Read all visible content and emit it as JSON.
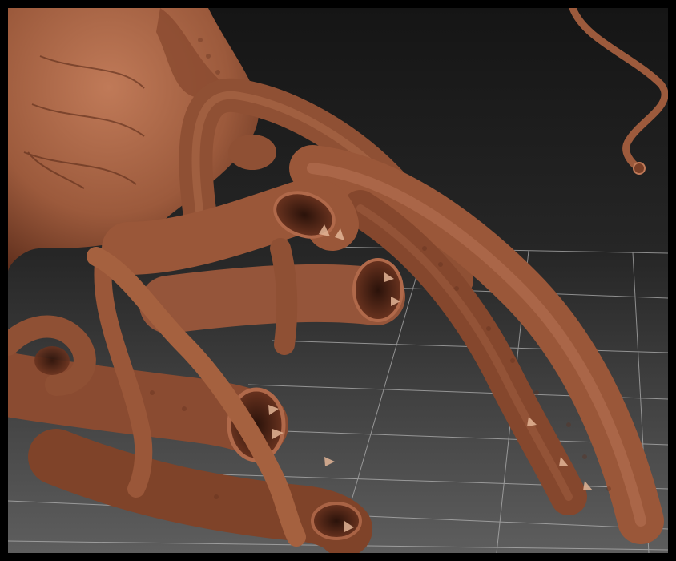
{
  "scene": {
    "subject": "clay-render-creature-with-tentacles",
    "clay_color": "#9c5a3c",
    "clay_shadow": "#4a2416",
    "clay_highlight": "#c98462",
    "background_top": "#1a1a1a",
    "background_bottom": "#5a5a5a",
    "grid_color": "#bdbdbd",
    "frame_color": "#000000"
  }
}
